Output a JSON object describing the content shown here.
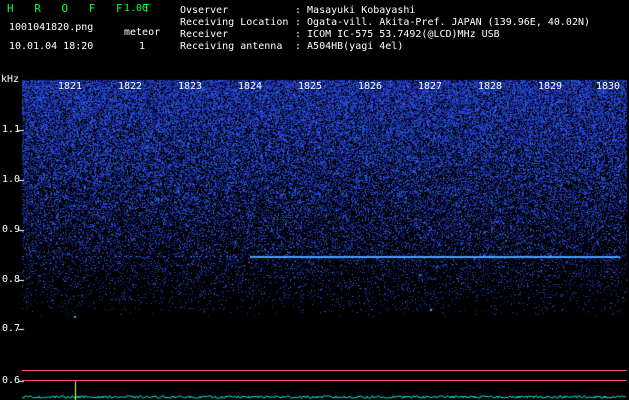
{
  "app": {
    "title": "H R O F F T",
    "version": "1.00"
  },
  "file": {
    "name": "1001041820.png",
    "timestamp": "10.01.04 18:20"
  },
  "meteor": {
    "label": "meteor",
    "count": "1"
  },
  "header": {
    "rows": [
      {
        "label": "Ovserver",
        "value": ": Masayuki Kobayashi"
      },
      {
        "label": "Receiving Location",
        "value": ": Ogata-vill. Akita-Pref. JAPAN (139.96E, 40.02N)"
      },
      {
        "label": "Receiver",
        "value": ": ICOM IC-575 53.7492(@LCD)MHz USB"
      },
      {
        "label": "Receiving antenna",
        "value": ": A504HB(yagi 4el)"
      }
    ]
  },
  "axis": {
    "y_unit": "kHz",
    "y_ticks": [
      "1.1",
      "1.0",
      "0.9",
      "0.8",
      "0.7",
      "0.6"
    ],
    "x_ticks": [
      "1821",
      "1822",
      "1823",
      "1824",
      "1825",
      "1826",
      "1827",
      "1828",
      "1829",
      "1830"
    ]
  },
  "colors": {
    "background": "#000000",
    "noise": "#2a44ff",
    "trace": "#4aa0ff",
    "reference_line": "#ff4a8a",
    "signal": "#00e0c0",
    "title_green": "#00ff40"
  }
}
